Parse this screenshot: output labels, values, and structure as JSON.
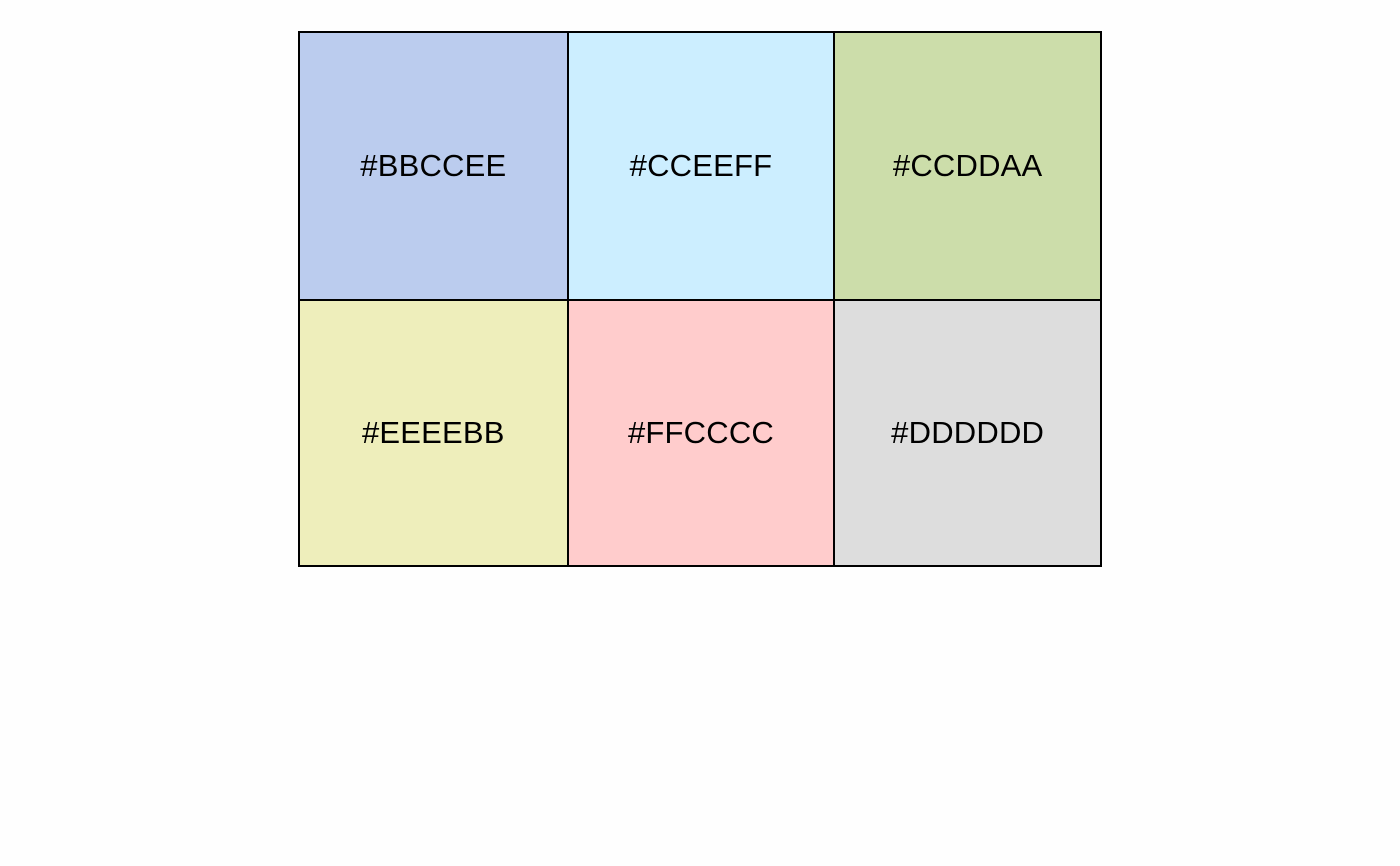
{
  "swatches": [
    {
      "label": "#BBCCEE",
      "color": "#BBCCEE"
    },
    {
      "label": "#CCEEFF",
      "color": "#CCEEFF"
    },
    {
      "label": "#CCDDAA",
      "color": "#CCDDAA"
    },
    {
      "label": "#EEEEBB",
      "color": "#EEEEBB"
    },
    {
      "label": "#FFCCCC",
      "color": "#FFCCCC"
    },
    {
      "label": "#DDDDDD",
      "color": "#DDDDDD"
    }
  ]
}
